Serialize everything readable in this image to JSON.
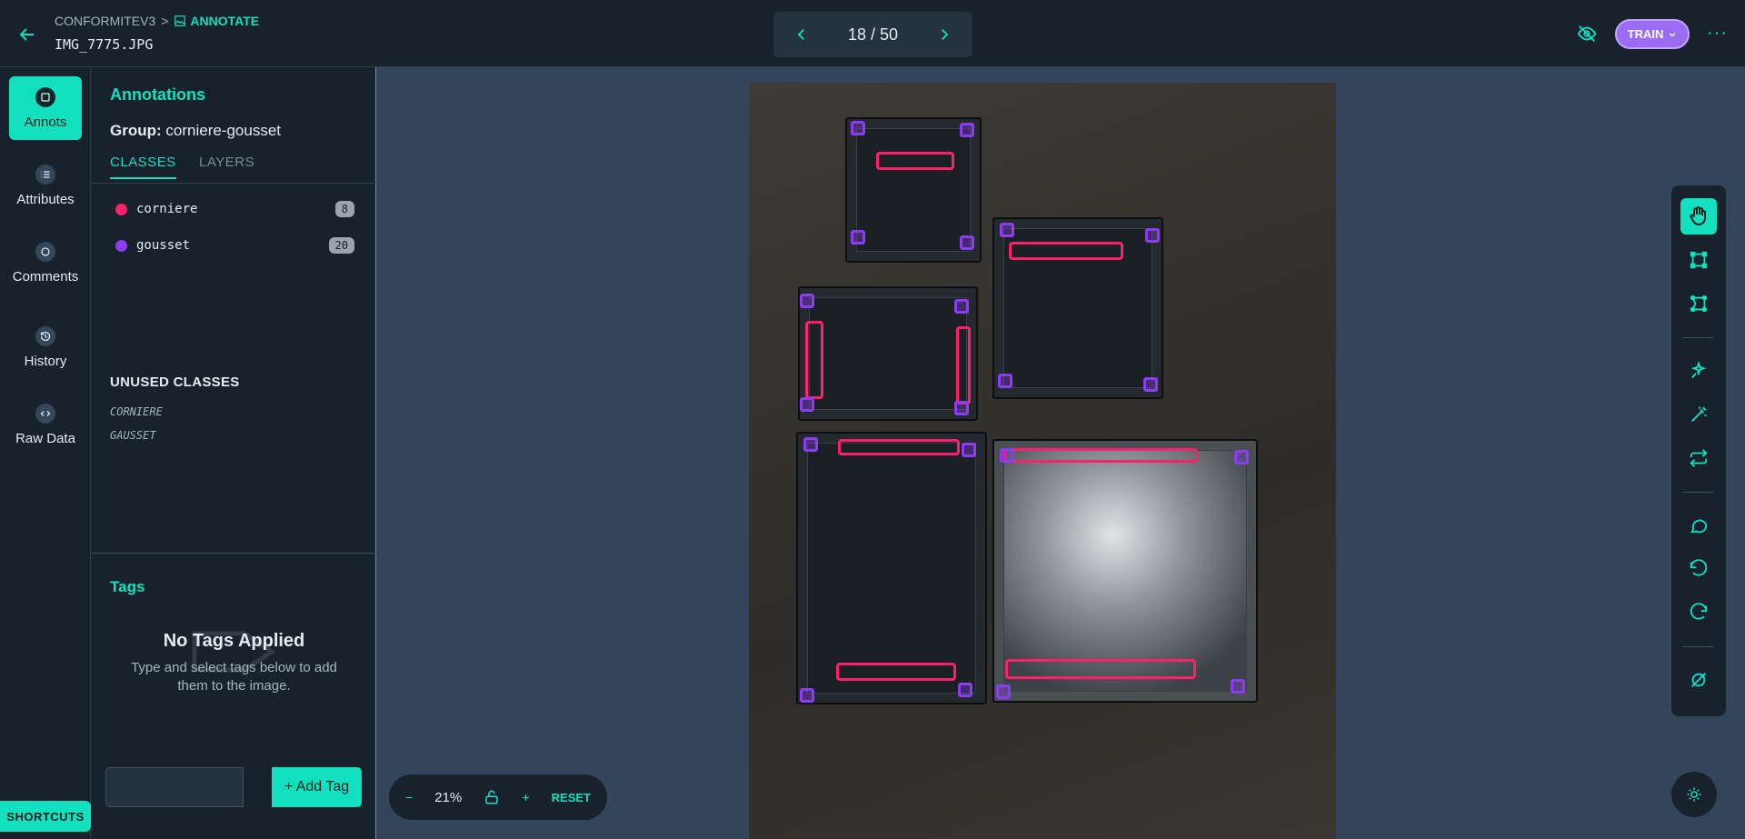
{
  "header": {
    "project": "CONFORMITEV3",
    "separator": ">",
    "section": "ANNOTATE",
    "filename": "IMG_7775.JPG",
    "pager": "18 / 50",
    "train_label": "TRAIN",
    "more": "···"
  },
  "nav": {
    "items": [
      {
        "label": "Annots",
        "icon": "annotations-icon"
      },
      {
        "label": "Attributes",
        "icon": "list-icon"
      },
      {
        "label": "Comments",
        "icon": "comment-icon"
      },
      {
        "label": "History",
        "icon": "history-icon"
      },
      {
        "label": "Raw Data",
        "icon": "code-icon"
      }
    ],
    "shortcuts": "SHORTCUTS"
  },
  "panel": {
    "title": "Annotations",
    "group_label": "Group:",
    "group_value": "corniere-gousset",
    "tabs": [
      "CLASSES",
      "LAYERS"
    ],
    "classes": [
      {
        "name": "corniere",
        "count": "8",
        "color": "#ff1f6a"
      },
      {
        "name": "gousset",
        "count": "20",
        "color": "#8c3df0"
      }
    ],
    "unused_title": "UNUSED CLASSES",
    "unused": [
      "CORNIERE",
      "GAUSSET"
    ],
    "tags_title": "Tags",
    "no_tags": "No Tags Applied",
    "no_tags_sub": "Type and select tags below to add them to the image.",
    "add_tag": "+ Add Tag"
  },
  "zoom": {
    "minus": "−",
    "level": "21%",
    "plus": "+",
    "reset": "RESET"
  },
  "colors": {
    "accent": "#12e0bf",
    "train": "#9b6cf2",
    "corniere": "#ff1f6a",
    "gousset": "#8c3df0"
  }
}
